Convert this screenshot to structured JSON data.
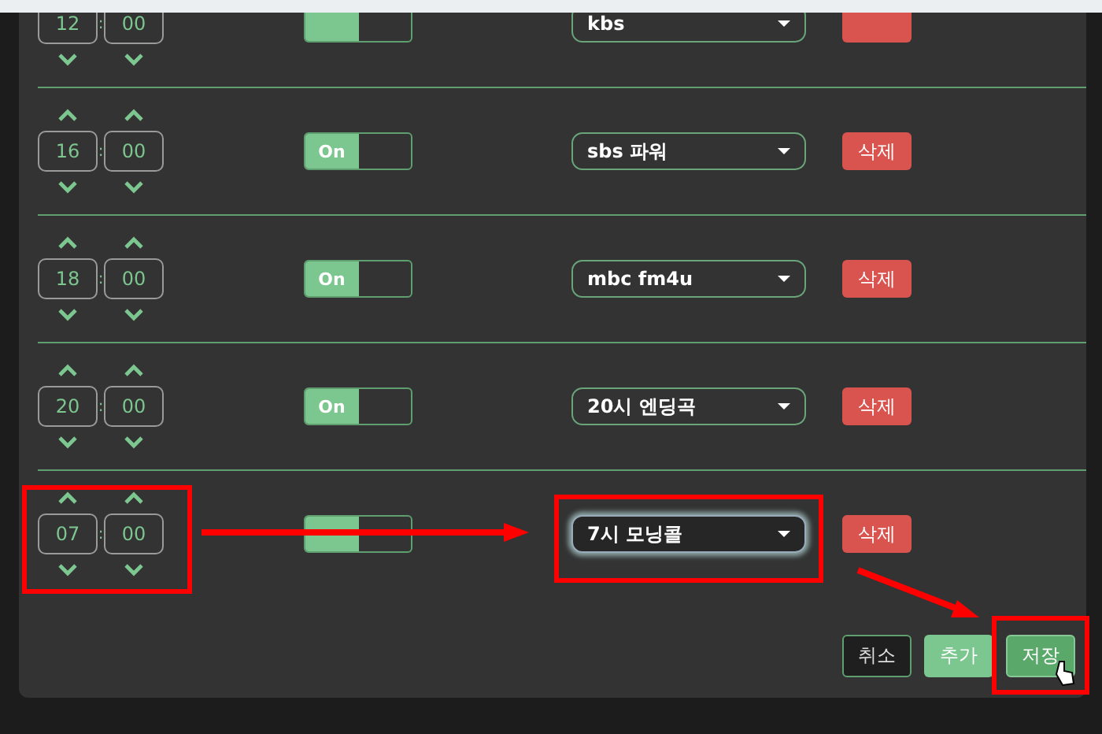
{
  "rows": [
    {
      "hour": "12",
      "separator": ":",
      "minute": "00",
      "enabled": true,
      "channel": "kbs",
      "focused": false
    },
    {
      "hour": "16",
      "separator": ":",
      "minute": "00",
      "enabled": true,
      "toggle_label": "On",
      "channel": "sbs 파워",
      "focused": false,
      "delete_label": "삭제"
    },
    {
      "hour": "18",
      "separator": ":",
      "minute": "00",
      "enabled": true,
      "toggle_label": "On",
      "channel": "mbc fm4u",
      "focused": false,
      "delete_label": "삭제"
    },
    {
      "hour": "20",
      "separator": ":",
      "minute": "00",
      "enabled": true,
      "toggle_label": "On",
      "channel": "20시 엔딩곡",
      "focused": false,
      "delete_label": "삭제"
    },
    {
      "hour": "07",
      "separator": ":",
      "minute": "00",
      "enabled": true,
      "channel": "7시 모닝콜",
      "focused": true,
      "delete_label": "삭제"
    }
  ],
  "footer_buttons": [
    {
      "kind": "cancel",
      "label": "취소"
    },
    {
      "kind": "add",
      "label": "추가"
    },
    {
      "kind": "save",
      "label": "저장"
    }
  ]
}
